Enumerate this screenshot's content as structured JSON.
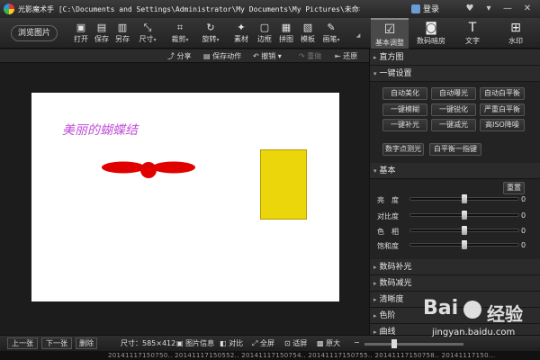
{
  "titlebar": {
    "app_name": "光影魔术手",
    "path": "[C:\\Documents and Settings\\Administrator\\My Documents\\My Pictures\\未命名_副本.bmp]",
    "login_label": "登录"
  },
  "toolbar": {
    "browse_label": "浏览图片",
    "tools": [
      {
        "label": "打开",
        "icon": "open-icon"
      },
      {
        "label": "保存",
        "icon": "save-icon"
      },
      {
        "label": "另存",
        "icon": "save-as-icon"
      },
      {
        "label": "尺寸",
        "icon": "resize-icon"
      },
      {
        "label": "裁剪",
        "icon": "crop-icon"
      },
      {
        "label": "旋转",
        "icon": "rotate-icon"
      },
      {
        "label": "素材",
        "icon": "material-icon"
      },
      {
        "label": "边框",
        "icon": "border-icon"
      },
      {
        "label": "拼图",
        "icon": "collage-icon"
      },
      {
        "label": "模板",
        "icon": "template-icon"
      },
      {
        "label": "画笔",
        "icon": "brush-icon"
      }
    ],
    "right_tabs": [
      {
        "label": "基本调整",
        "icon": "adjust-icon"
      },
      {
        "label": "数码暗房",
        "icon": "camera-icon"
      },
      {
        "label": "文字",
        "icon": "text-icon"
      },
      {
        "label": "水印",
        "icon": "watermark-icon"
      }
    ]
  },
  "subtoolbar": {
    "share": "分享",
    "save_action": "保存动作",
    "undo": "撤销",
    "redo": "重做",
    "restore": "还原"
  },
  "image": {
    "caption": "美丽的蝴蝶结",
    "colors": {
      "bow": "#e00000",
      "rect": "#ead60a",
      "caption": "#c24fd6"
    }
  },
  "panel": {
    "histogram": "直方图",
    "one_click": "一键设置",
    "one_click_buttons": [
      "自动美化",
      "自动曝光",
      "自动白平衡",
      "一键模糊",
      "一键锐化",
      "严重白平衡",
      "一键补光",
      "一键减光",
      "高ISO降噪"
    ],
    "extra_buttons": [
      "数字点测光",
      "白平衡一指键"
    ],
    "basic": "基本",
    "reset": "重置",
    "sliders": [
      {
        "label": "亮　度",
        "value": "0"
      },
      {
        "label": "对比度",
        "value": "0"
      },
      {
        "label": "色　相",
        "value": "0"
      },
      {
        "label": "饱和度",
        "value": "0"
      }
    ],
    "sections": [
      "数码补光",
      "数码减光",
      "清晰度",
      "色阶",
      "曲线"
    ]
  },
  "statusbar": {
    "prev": "上一张",
    "next": "下一张",
    "delete": "删除",
    "size": "尺寸：585×412",
    "info": "图片信息",
    "compare": "对比",
    "fullscreen": "全屏",
    "fit": "适屏",
    "original": "原大"
  },
  "strip": {
    "text": "20141117150750..  20141117150552..  20141117150754..  20141117150755..  20141117150758..  20141117150..."
  },
  "watermark": {
    "brand": "Bai",
    "jingyan": "经验",
    "url": "jingyan.baidu.com"
  }
}
